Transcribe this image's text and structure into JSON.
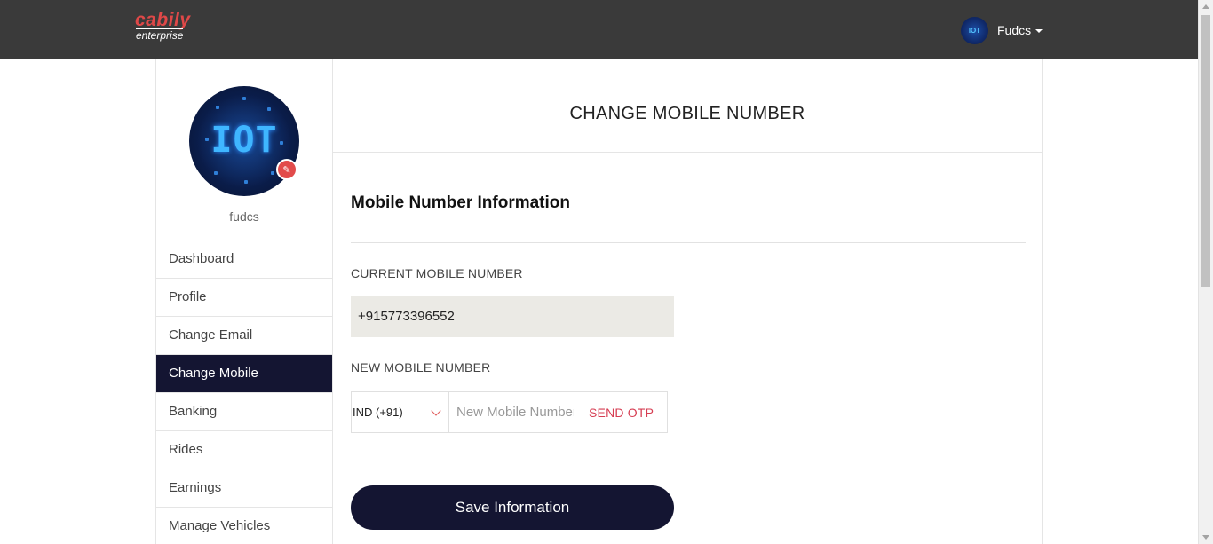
{
  "header": {
    "brand_main": "cabily",
    "brand_sub": "enterprise",
    "user_name": "Fudcs",
    "avatar_text": "IOT"
  },
  "sidebar": {
    "avatar_text": "IOT",
    "username": "fudcs",
    "items": [
      {
        "label": "Dashboard"
      },
      {
        "label": "Profile"
      },
      {
        "label": "Change Email"
      },
      {
        "label": "Change Mobile"
      },
      {
        "label": "Banking"
      },
      {
        "label": "Rides"
      },
      {
        "label": "Earnings"
      },
      {
        "label": "Manage Vehicles"
      }
    ],
    "active_item": "Change Mobile"
  },
  "main": {
    "page_title": "CHANGE MOBILE NUMBER",
    "section_title": "Mobile Number Information",
    "current_label": "CURRENT MOBILE NUMBER",
    "current_value": "+915773396552",
    "new_label": "NEW MOBILE NUMBER",
    "country_code": "IND (+91)",
    "new_placeholder": "New Mobile Number",
    "send_otp_label": "SEND OTP",
    "save_label": "Save Information"
  },
  "colors": {
    "topbar": "#3a3a3a",
    "brand_red": "#e04848",
    "navy": "#141532",
    "otp_red": "#d63d52",
    "readonly_bg": "#ebeae5"
  }
}
